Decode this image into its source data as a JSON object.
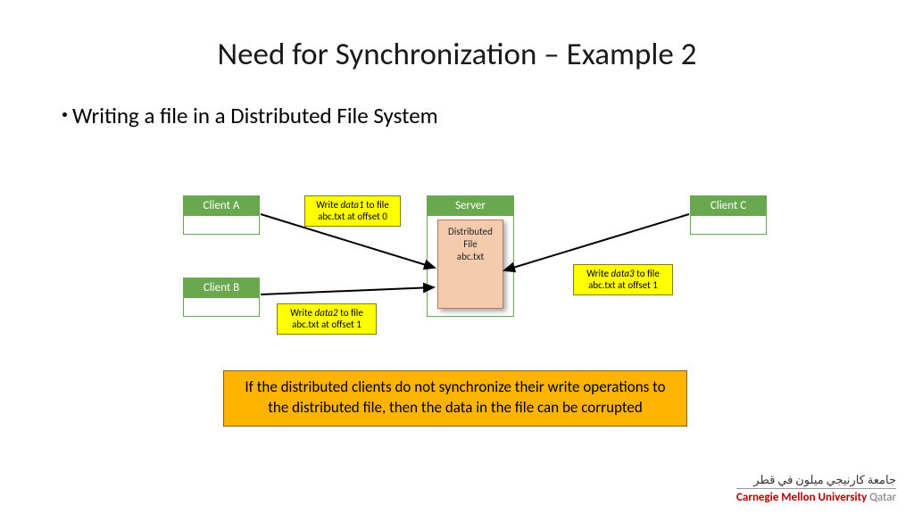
{
  "title": "Need for Synchronization – Example 2",
  "bullet": "Writing a file in a Distributed File System",
  "boxes": {
    "clientA": "Client A",
    "clientB": "Client B",
    "clientC": "Client C",
    "server": "Server"
  },
  "file": {
    "line1": "Distributed",
    "line2": "File",
    "line3": "abc.txt"
  },
  "notes": {
    "n1a": "Write ",
    "n1em": "data1",
    "n1b": " to file",
    "n1c": "abc.txt at offset 0",
    "n2a": "Write ",
    "n2em": "data2",
    "n2b": " to file",
    "n2c": "abc.txt at offset 1",
    "n3a": "Write ",
    "n3em": "data3",
    "n3b": " to file",
    "n3c": "abc.txt at offset 1"
  },
  "callout": "If the distributed clients do not synchronize their write operations to the distributed file, then the data in the file can be corrupted",
  "footer": {
    "arabic": "جامعة كارنيجي ميلون في قطر",
    "cmu_red": "Carnegie Mellon University",
    "cmu_gray": " Qatar"
  }
}
